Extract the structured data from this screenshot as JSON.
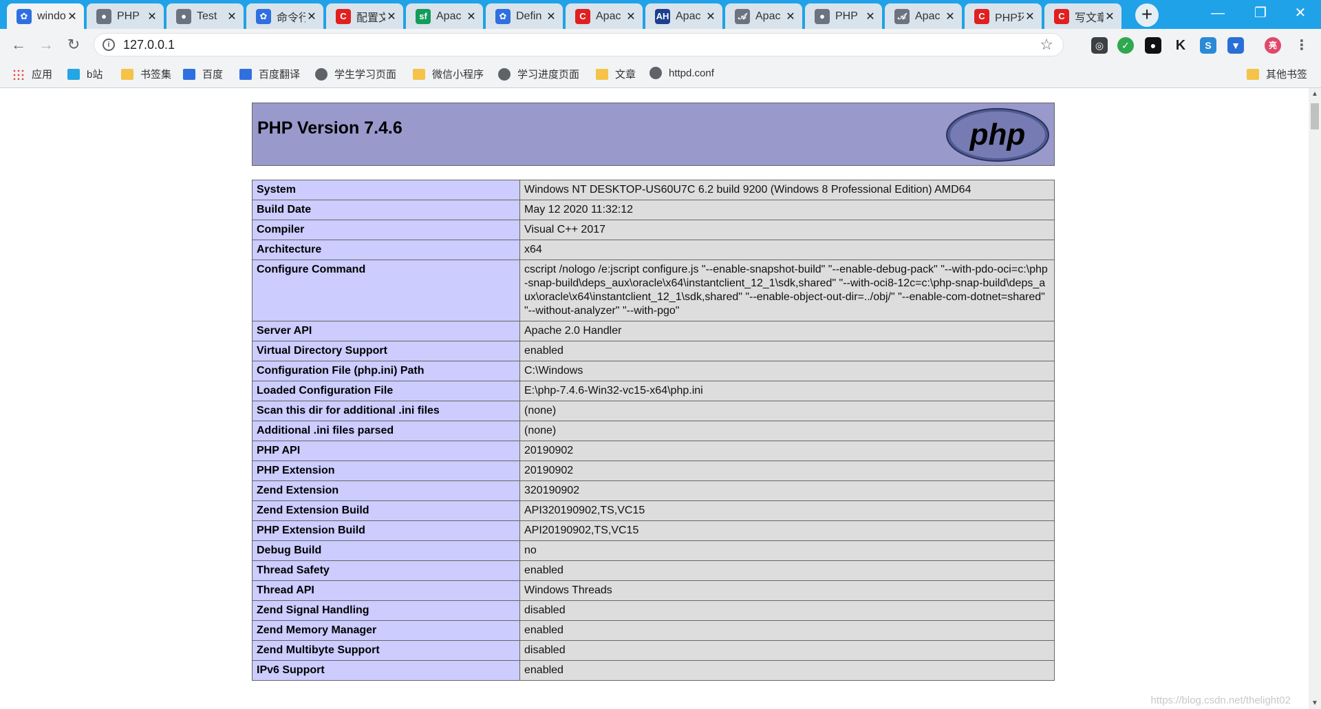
{
  "browser": {
    "tabs": [
      {
        "title": "windo",
        "icon": "paw-icon",
        "color": "#2f6fe0",
        "glyph": "✿",
        "active": true
      },
      {
        "title": "PHP",
        "icon": "globe-icon",
        "color": "#6b7280",
        "glyph": "●",
        "active": false
      },
      {
        "title": "Test",
        "icon": "globe-icon",
        "color": "#6b7280",
        "glyph": "●",
        "active": false
      },
      {
        "title": "命令行",
        "icon": "paw-icon",
        "color": "#2f6fe0",
        "glyph": "✿",
        "active": false
      },
      {
        "title": "配置文",
        "icon": "csdn-icon",
        "color": "#e02020",
        "glyph": "C",
        "active": false
      },
      {
        "title": "Apac",
        "icon": "sf-icon",
        "color": "#149c59",
        "glyph": "sf",
        "active": false
      },
      {
        "title": "Defin",
        "icon": "paw-icon",
        "color": "#2f6fe0",
        "glyph": "✿",
        "active": false
      },
      {
        "title": "Apac",
        "icon": "csdn-icon",
        "color": "#e02020",
        "glyph": "C",
        "active": false
      },
      {
        "title": "Apac",
        "icon": "ah-icon",
        "color": "#1c3f8f",
        "glyph": "AH",
        "active": false
      },
      {
        "title": "Apac",
        "icon": "feather-icon",
        "color": "#6b7280",
        "glyph": "𝒜",
        "active": false
      },
      {
        "title": "PHP",
        "icon": "globe-icon",
        "color": "#6b7280",
        "glyph": "●",
        "active": false
      },
      {
        "title": "Apac",
        "icon": "feather-icon",
        "color": "#6b7280",
        "glyph": "𝒜",
        "active": false
      },
      {
        "title": "PHP环",
        "icon": "csdn-icon",
        "color": "#e02020",
        "glyph": "C",
        "active": false
      },
      {
        "title": "写文章",
        "icon": "csdn-icon",
        "color": "#e02020",
        "glyph": "C",
        "active": false
      }
    ],
    "url": "127.0.0.1",
    "bookmarks": [
      {
        "label": "应用",
        "icon": "apps-icon",
        "kind": "apps"
      },
      {
        "label": "b站",
        "icon": "bilibili-icon",
        "kind": "bili"
      },
      {
        "label": "书签集",
        "icon": "folder-icon",
        "kind": "folder"
      },
      {
        "label": "百度",
        "icon": "paw-icon",
        "kind": "paw"
      },
      {
        "label": "百度翻译",
        "icon": "translate-icon",
        "kind": "translate"
      },
      {
        "label": "学生学习页面",
        "icon": "globe-icon",
        "kind": "globe"
      },
      {
        "label": "微信小程序",
        "icon": "folder-icon",
        "kind": "folder"
      },
      {
        "label": "学习进度页面",
        "icon": "globe-icon",
        "kind": "globe"
      },
      {
        "label": "文章",
        "icon": "folder-icon",
        "kind": "folder"
      },
      {
        "label": "httpd.conf",
        "icon": "globe-icon",
        "kind": "globe"
      }
    ],
    "other_bookmarks": "其他书签",
    "avatar_text": "亮"
  },
  "phpinfo": {
    "title": "PHP Version 7.4.6",
    "logo_text": "php",
    "rows": [
      {
        "name": "System",
        "value": "Windows NT DESKTOP-US60U7C 6.2 build 9200 (Windows 8 Professional Edition) AMD64"
      },
      {
        "name": "Build Date",
        "value": "May 12 2020 11:32:12"
      },
      {
        "name": "Compiler",
        "value": "Visual C++ 2017"
      },
      {
        "name": "Architecture",
        "value": "x64"
      },
      {
        "name": "Configure Command",
        "value": "cscript /nologo /e:jscript configure.js \"--enable-snapshot-build\" \"--enable-debug-pack\" \"--with-pdo-oci=c:\\php-snap-build\\deps_aux\\oracle\\x64\\instantclient_12_1\\sdk,shared\" \"--with-oci8-12c=c:\\php-snap-build\\deps_aux\\oracle\\x64\\instantclient_12_1\\sdk,shared\" \"--enable-object-out-dir=../obj/\" \"--enable-com-dotnet=shared\" \"--without-analyzer\" \"--with-pgo\""
      },
      {
        "name": "Server API",
        "value": "Apache 2.0 Handler"
      },
      {
        "name": "Virtual Directory Support",
        "value": "enabled"
      },
      {
        "name": "Configuration File (php.ini) Path",
        "value": "C:\\Windows"
      },
      {
        "name": "Loaded Configuration File",
        "value": "E:\\php-7.4.6-Win32-vc15-x64\\php.ini"
      },
      {
        "name": "Scan this dir for additional .ini files",
        "value": "(none)"
      },
      {
        "name": "Additional .ini files parsed",
        "value": "(none)"
      },
      {
        "name": "PHP API",
        "value": "20190902"
      },
      {
        "name": "PHP Extension",
        "value": "20190902"
      },
      {
        "name": "Zend Extension",
        "value": "320190902"
      },
      {
        "name": "Zend Extension Build",
        "value": "API320190902,TS,VC15"
      },
      {
        "name": "PHP Extension Build",
        "value": "API20190902,TS,VC15"
      },
      {
        "name": "Debug Build",
        "value": "no"
      },
      {
        "name": "Thread Safety",
        "value": "enabled"
      },
      {
        "name": "Thread API",
        "value": "Windows Threads"
      },
      {
        "name": "Zend Signal Handling",
        "value": "disabled"
      },
      {
        "name": "Zend Memory Manager",
        "value": "enabled"
      },
      {
        "name": "Zend Multibyte Support",
        "value": "disabled"
      },
      {
        "name": "IPv6 Support",
        "value": "enabled"
      }
    ]
  },
  "watermark": "https://blog.csdn.net/thelight02",
  "colors": {
    "tabstrip": "#1fa2e8",
    "header": "#9999cc",
    "label_cell": "#ccccff",
    "value_cell": "#dddddd"
  }
}
